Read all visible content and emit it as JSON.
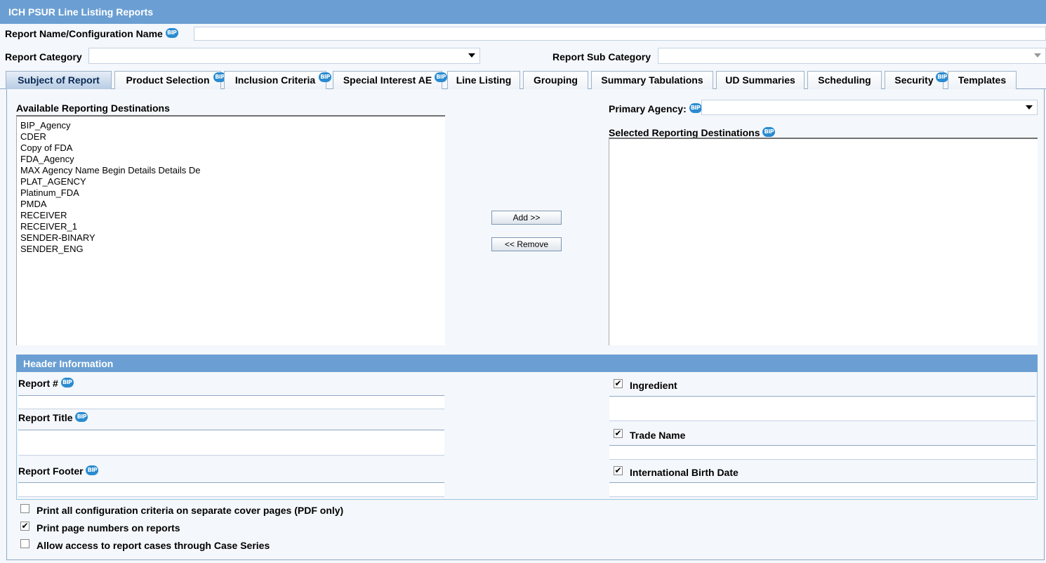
{
  "window": {
    "title": "ICH PSUR Line Listing Reports"
  },
  "bip_badge": "BIP",
  "form": {
    "report_name_label": "Report Name/Configuration Name",
    "report_name_value": "",
    "report_category_label": "Report Category",
    "report_category_value": "",
    "report_sub_category_label": "Report Sub Category",
    "report_sub_category_value": ""
  },
  "tabs": [
    {
      "label": "Subject of Report",
      "active": true
    },
    {
      "label": "Product Selection",
      "bip": true
    },
    {
      "label": "Inclusion Criteria",
      "bip": true
    },
    {
      "label": "Special Interest AE",
      "bip": true
    },
    {
      "label": "Line Listing"
    },
    {
      "label": "Grouping"
    },
    {
      "label": "Summary Tabulations"
    },
    {
      "label": "UD Summaries"
    },
    {
      "label": "Scheduling"
    },
    {
      "label": "Security",
      "bip": true
    },
    {
      "label": "Templates"
    }
  ],
  "destinations": {
    "available_label": "Available Reporting Destinations",
    "available_items": [
      "BIP_Agency",
      "CDER",
      "Copy of FDA",
      "FDA_Agency",
      "MAX Agency Name Begin Details Details De",
      "PLAT_AGENCY",
      "Platinum_FDA",
      "PMDA",
      "RECEIVER",
      "RECEIVER_1",
      "SENDER-BINARY",
      "SENDER_ENG"
    ],
    "add_button": "Add >>",
    "remove_button": "<< Remove",
    "primary_agency_label": "Primary Agency:",
    "primary_agency_value": "",
    "selected_label": "Selected Reporting Destinations",
    "selected_items": []
  },
  "header_info": {
    "title": "Header Information",
    "report_number_label": "Report #",
    "report_number_value": "",
    "report_title_label": "Report Title",
    "report_title_value": "",
    "report_footer_label": "Report Footer",
    "report_footer_value": "",
    "ingredient_label": "Ingredient",
    "ingredient_checked": true,
    "trade_name_label": "Trade Name",
    "trade_name_checked": true,
    "ibd_label": "International Birth Date",
    "ibd_checked": true
  },
  "options": {
    "cover_pages_label": "Print all configuration criteria on separate cover pages (PDF only)",
    "cover_pages_checked": false,
    "page_numbers_label": "Print page numbers on reports",
    "page_numbers_checked": true,
    "case_series_label": "Allow access to report cases through Case Series",
    "case_series_checked": false
  },
  "checkmark_glyph": "✔"
}
